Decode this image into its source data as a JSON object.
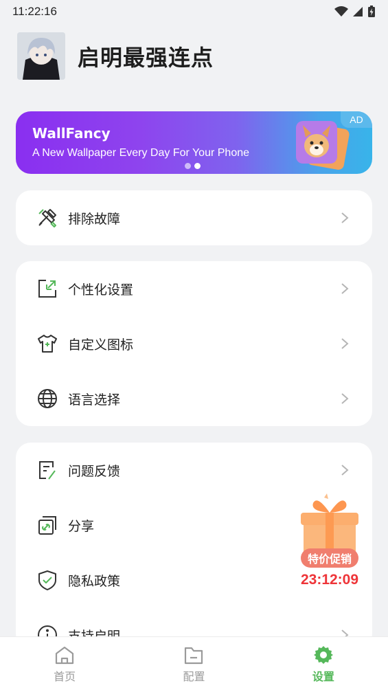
{
  "status": {
    "time": "11:22:16"
  },
  "profile": {
    "name": "启明最强连点"
  },
  "ad": {
    "title": "WallFancy",
    "subtitle": "A New Wallpaper Every Day For Your Phone",
    "badge": "AD"
  },
  "groups": [
    {
      "items": [
        {
          "label": "排除故障",
          "icon": "wrench-icon"
        }
      ]
    },
    {
      "items": [
        {
          "label": "个性化设置",
          "icon": "personalize-icon"
        },
        {
          "label": "自定义图标",
          "icon": "tshirt-icon"
        },
        {
          "label": "语言选择",
          "icon": "globe-icon"
        }
      ]
    },
    {
      "items": [
        {
          "label": "问题反馈",
          "icon": "feedback-icon"
        },
        {
          "label": "分享",
          "icon": "share-link-icon"
        },
        {
          "label": "隐私政策",
          "icon": "shield-check-icon"
        },
        {
          "label": "支持启明",
          "icon": "info-icon"
        }
      ]
    }
  ],
  "promo": {
    "label": "特价促销",
    "timer": "23:12:09"
  },
  "tabs": [
    {
      "label": "首页",
      "icon": "home-icon"
    },
    {
      "label": "配置",
      "icon": "folder-icon"
    },
    {
      "label": "设置",
      "icon": "gear-icon",
      "active": true
    }
  ],
  "colors": {
    "accent": "#55b85a",
    "timer": "#ee3438",
    "promo": "#f07e6e"
  }
}
